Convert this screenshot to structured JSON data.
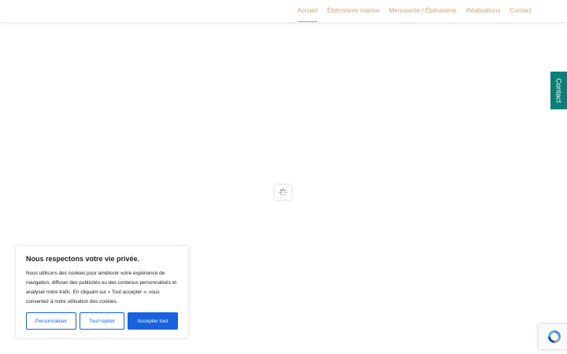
{
  "nav": {
    "items": [
      {
        "label": "Accueil",
        "active": true
      },
      {
        "label": "Ébénisterie marine",
        "active": false
      },
      {
        "label": "Menuiserie / Ébénisterie",
        "active": false
      },
      {
        "label": "Réalisations",
        "active": false
      },
      {
        "label": "Contact",
        "active": false
      }
    ]
  },
  "contact_tab": {
    "label": "Contact"
  },
  "loader": {
    "icon": "spinner-icon"
  },
  "cookie": {
    "title": "Nous respectons votre vie privée.",
    "body": "Nous utilisons des cookies pour améliorer votre expérience de navigation, diffuser des publicités ou des contenus personnalisés et analyser notre trafic. En cliquant sur « Tout accepter », vous consentez à notre utilisation des cookies.",
    "buttons": {
      "customize": "Personnaliser",
      "reject": "Tout rejeter",
      "accept": "Accepter tout"
    }
  },
  "recaptcha": {
    "icon": "recaptcha-icon"
  },
  "colors": {
    "accent": "#c8a77c",
    "contact_tab": "#0d7f79",
    "cookie_button": "#1863dc"
  }
}
